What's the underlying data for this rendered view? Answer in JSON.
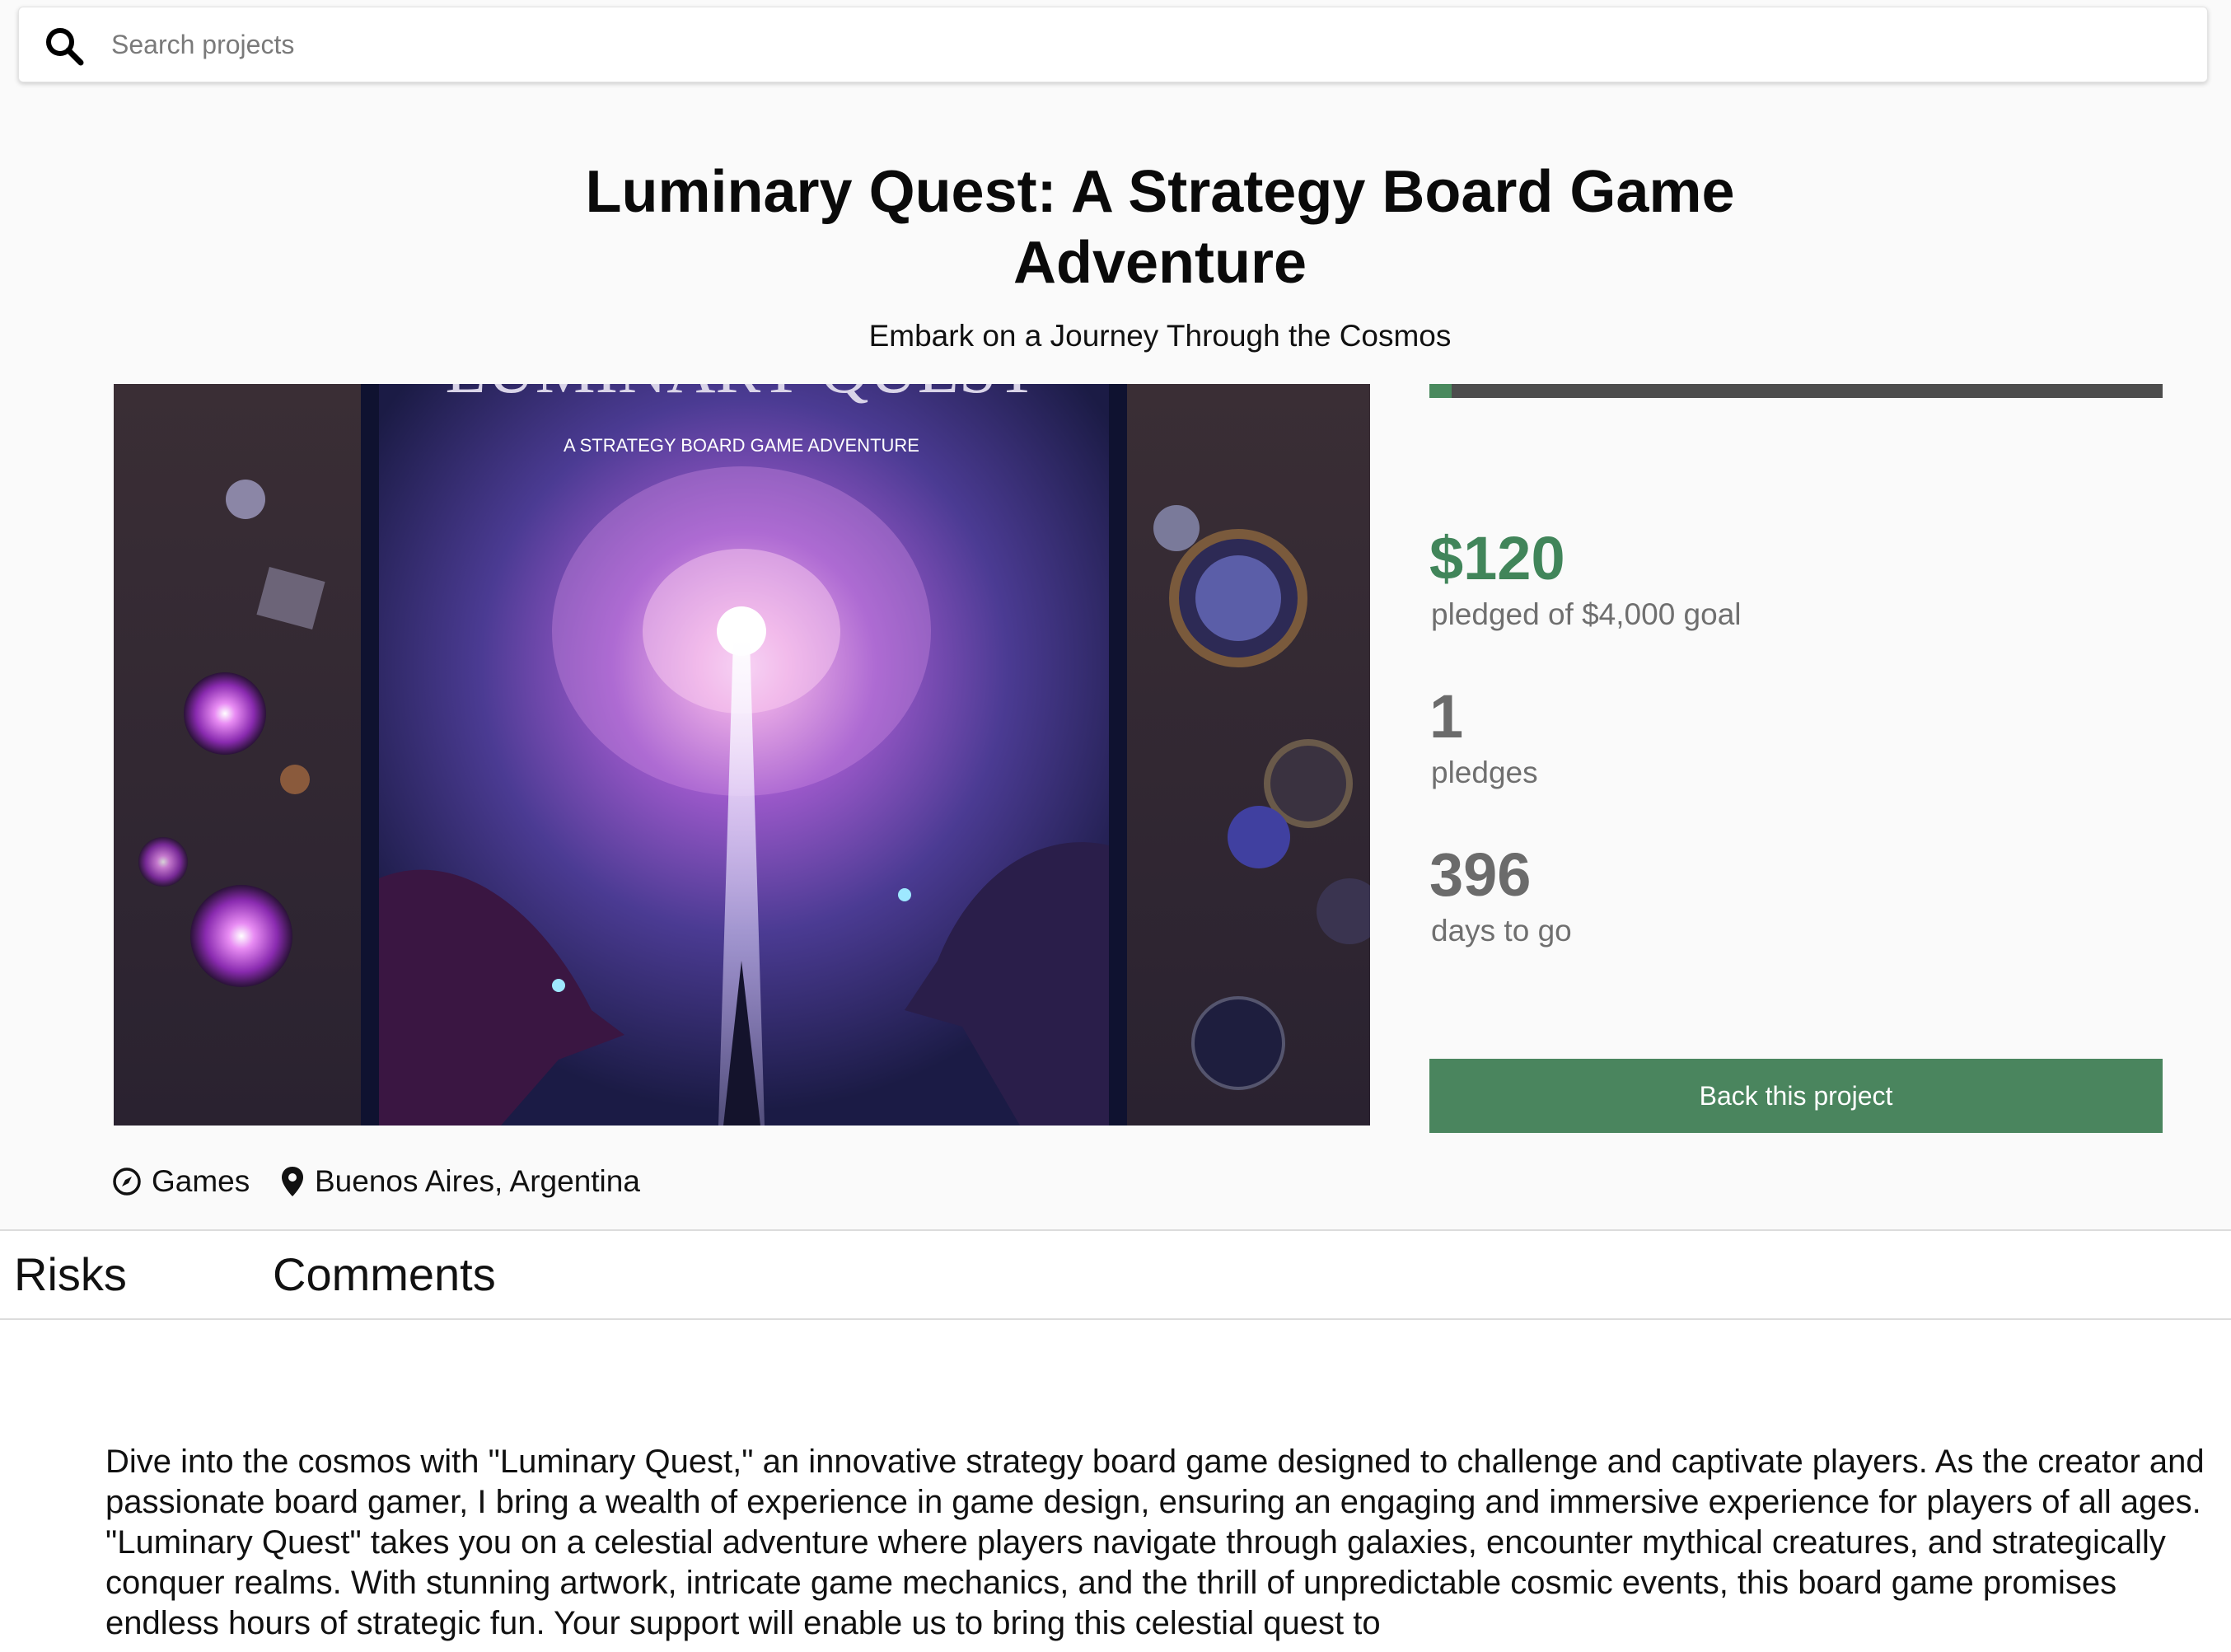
{
  "search": {
    "placeholder": "Search projects",
    "value": ""
  },
  "project": {
    "title_line1": "Luminary Quest: A Strategy Board Game",
    "title_line2": "Adventure",
    "subtitle": "Embark on a Journey Through the Cosmos",
    "image": {
      "cover_text": "A STRATEGY BOARD GAME ADVENTURE",
      "cover_title": "LUMINARY QUEST"
    },
    "category": "Games",
    "location": "Buenos Aires, Argentina"
  },
  "stats": {
    "pledged": "$120",
    "pledged_label": "pledged of $4,000 goal",
    "pledges": "1",
    "pledges_label": "pledges",
    "days": "396",
    "days_label": "days to go",
    "funded_fraction": 0.03
  },
  "actions": {
    "back_label": "Back this project"
  },
  "tabs": [
    {
      "label": "Risks"
    },
    {
      "label": "Comments"
    }
  ],
  "description": "Dive into the cosmos with \"Luminary Quest,\" an innovative strategy board game designed to challenge and captivate players. As the creator and passionate board gamer, I bring a wealth of experience in game design, ensuring an engaging and immersive experience for players of all ages. \"Luminary Quest\" takes you on a celestial adventure where players navigate through galaxies, encounter mythical creatures, and strategically conquer realms. With stunning artwork, intricate game mechanics, and the thrill of unpredictable cosmic events, this board game promises endless hours of strategic fun. Your support will enable us to bring this celestial quest to",
  "colors": {
    "accent_green": "#41855a",
    "button_green": "#4a855e",
    "progress_track": "#4d4d4d"
  },
  "icons": {
    "search": "search-icon",
    "category": "compass-icon",
    "location": "map-pin-icon"
  }
}
